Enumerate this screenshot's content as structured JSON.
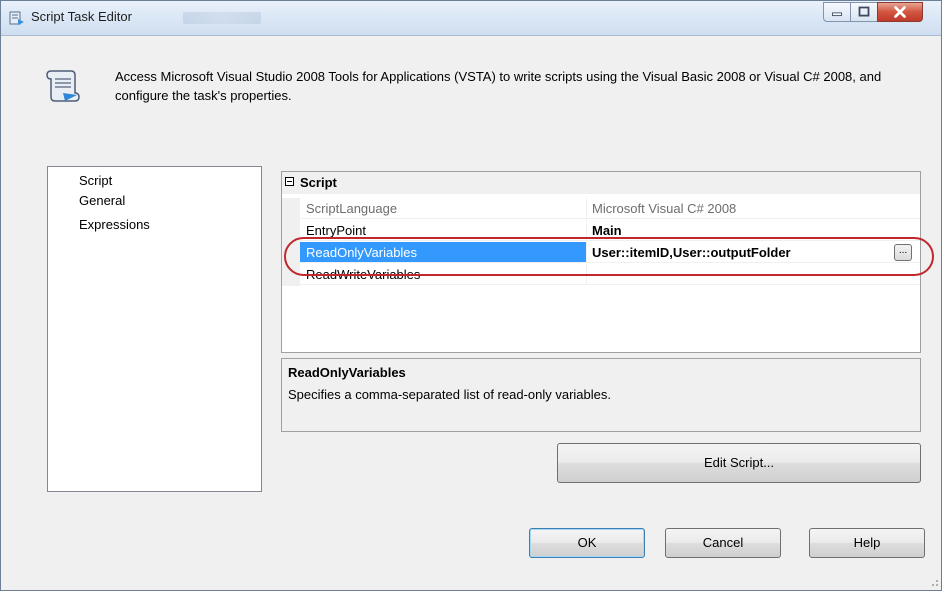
{
  "window": {
    "title": "Script Task Editor",
    "controls": {
      "minimize": "minimize-icon",
      "maximize": "maximize-icon",
      "close": "close-icon"
    }
  },
  "banner": {
    "icon": "script-scroll-icon",
    "text": "Access Microsoft Visual Studio 2008 Tools for Applications (VSTA) to write scripts using the Visual Basic 2008 or Visual C# 2008, and configure the task's properties."
  },
  "nav": {
    "items": [
      {
        "label": "Script"
      },
      {
        "label": "General"
      },
      {
        "label": "Expressions"
      }
    ]
  },
  "grid": {
    "category": "Script",
    "properties": [
      {
        "name": "ScriptLanguage",
        "value": "Microsoft Visual C# 2008"
      },
      {
        "name": "EntryPoint",
        "value": "Main"
      },
      {
        "name": "ReadOnlyVariables",
        "value": "User::itemID,User::outputFolder",
        "button": "..."
      },
      {
        "name": "ReadWriteVariables",
        "value": ""
      }
    ]
  },
  "description": {
    "title": "ReadOnlyVariables",
    "text": "Specifies a comma-separated list of read-only variables."
  },
  "buttons": {
    "edit_script": "Edit Script...",
    "ok": "OK",
    "cancel": "Cancel",
    "help": "Help"
  },
  "colors": {
    "selection": "#3399ff",
    "highlight_oval": "#c0282d"
  }
}
